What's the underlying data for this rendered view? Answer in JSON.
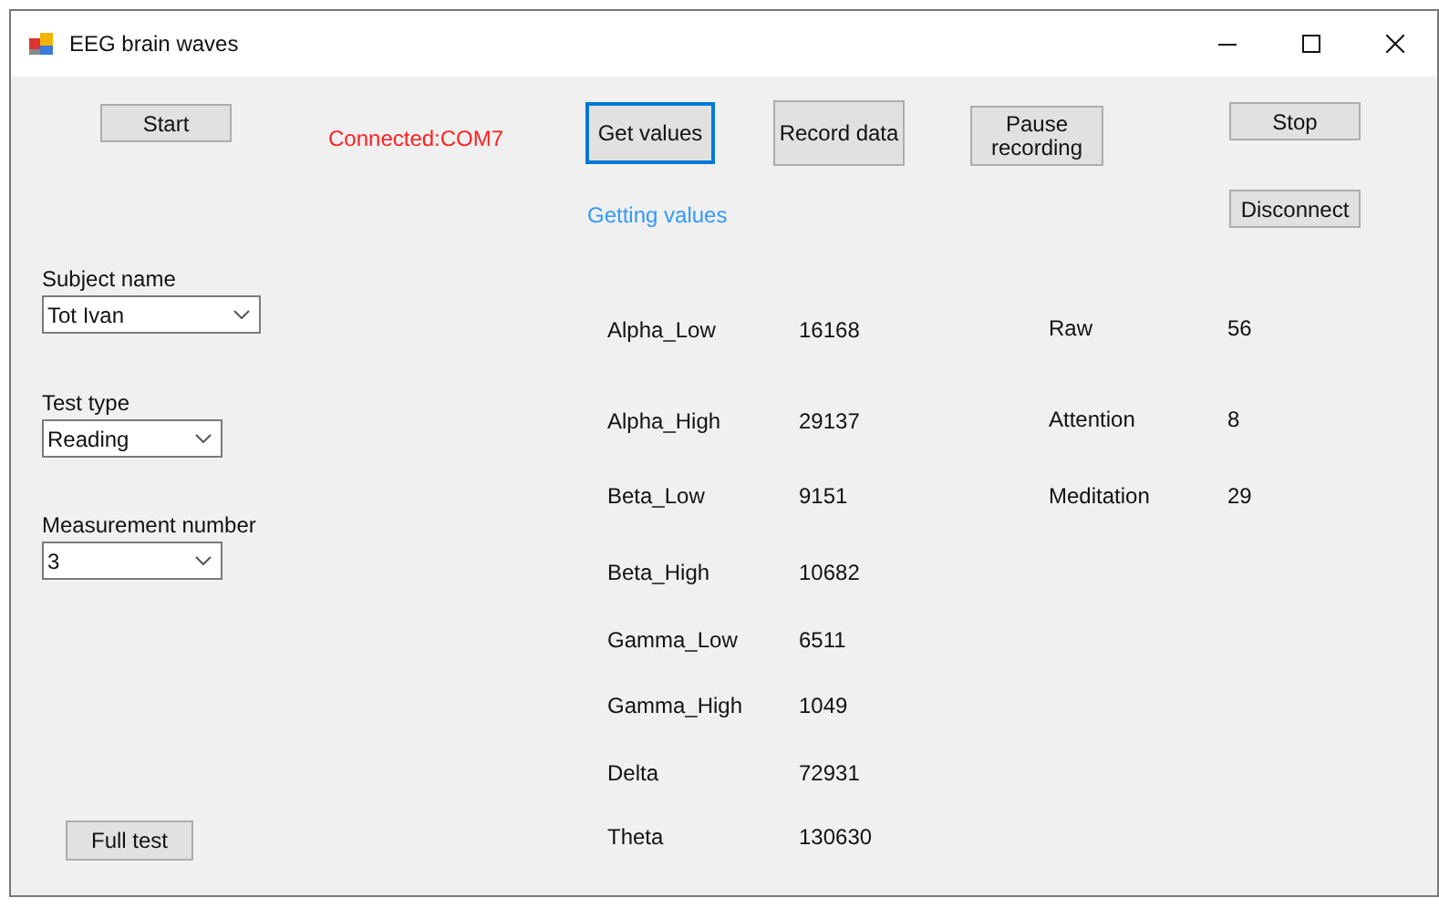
{
  "window": {
    "title": "EEG brain waves"
  },
  "buttons": [
    {
      "label": "Start",
      "focused": false
    },
    {
      "label": "Get values",
      "focused": true
    },
    {
      "label": "Record data",
      "focused": false
    },
    {
      "label": "Pause recording",
      "focused": false
    },
    {
      "label": "Stop",
      "focused": false
    },
    {
      "label": "Disconnect",
      "focused": false
    },
    {
      "label": "Full test",
      "focused": false
    }
  ],
  "connection_status": "Connected:COM7",
  "status_message": "Getting values",
  "fields": [
    {
      "label": "Subject name",
      "value": "Tot Ivan"
    },
    {
      "label": "Test type",
      "value": "Reading"
    },
    {
      "label": "Measurement number",
      "value": "3"
    }
  ],
  "band_values": [
    {
      "label": "Alpha_Low",
      "value": "16168"
    },
    {
      "label": "Alpha_High",
      "value": "29137"
    },
    {
      "label": "Beta_Low",
      "value": "9151"
    },
    {
      "label": "Beta_High",
      "value": "10682"
    },
    {
      "label": "Gamma_Low",
      "value": "6511"
    },
    {
      "label": "Gamma_High",
      "value": "1049"
    },
    {
      "label": "Delta",
      "value": "72931"
    },
    {
      "label": "Theta",
      "value": "130630"
    }
  ],
  "signal_values": [
    {
      "label": "Raw",
      "value": "56"
    },
    {
      "label": "Attention",
      "value": "8"
    },
    {
      "label": "Meditation",
      "value": "29"
    }
  ]
}
